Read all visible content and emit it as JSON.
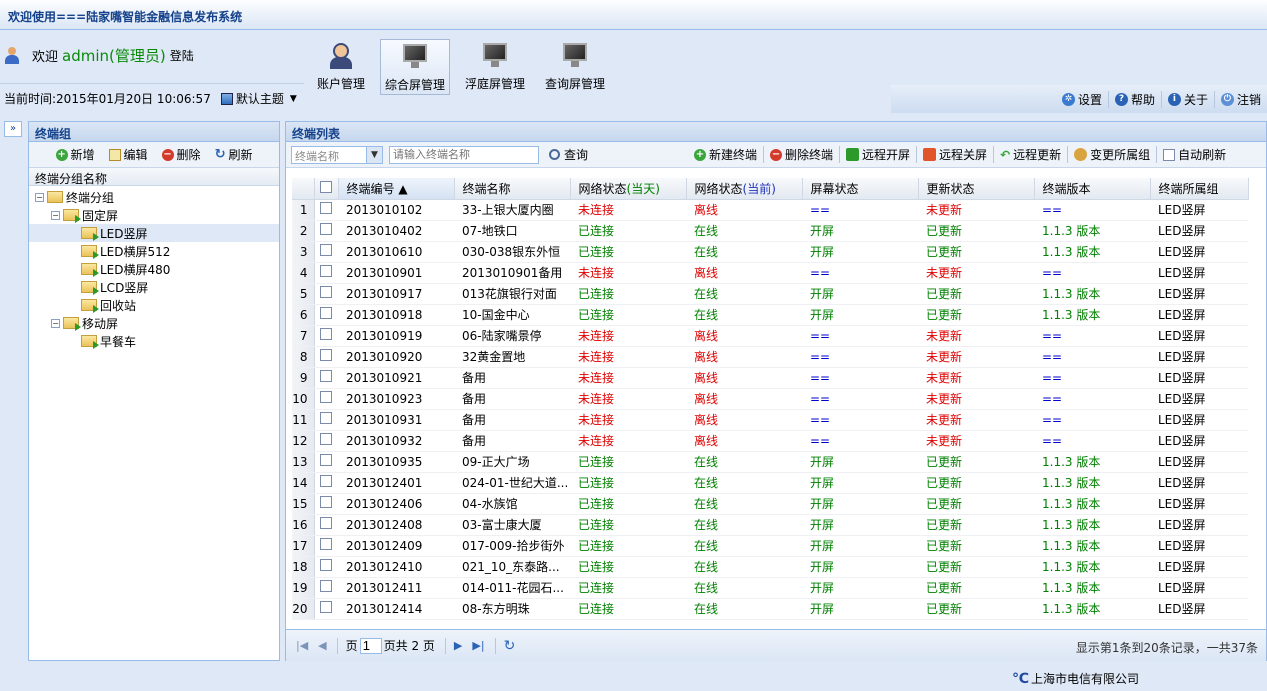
{
  "app": {
    "title": "欢迎使用===陆家嘴智能金融信息发布系统"
  },
  "header": {
    "welcome": "欢迎",
    "username": "admin(管理员)",
    "login": "登陆",
    "time_label": "当前时间:2015年01月20日 10:06:57",
    "theme": "默认主题",
    "nav": [
      {
        "label": "账户管理"
      },
      {
        "label": "综合屏管理"
      },
      {
        "label": "浮庭屏管理"
      },
      {
        "label": "查询屏管理"
      }
    ],
    "tools": [
      "设置",
      "帮助",
      "关于",
      "注销"
    ]
  },
  "left": {
    "title": "终端组",
    "buttons": {
      "add": "新增",
      "edit": "编辑",
      "delete": "删除",
      "refresh": "刷新"
    },
    "tree_header": "终端分组名称",
    "tree": {
      "root": "终端分组",
      "fixed": "固定屏",
      "fixed_children": [
        "LED竖屏",
        "LED横屏512",
        "LED横屏480",
        "LCD竖屏",
        "回收站"
      ],
      "mobile": "移动屏",
      "mobile_children": [
        "早餐车"
      ]
    }
  },
  "right": {
    "title": "终端列表",
    "combo": "终端名称",
    "search_placeholder": "请输入终端名称",
    "query": "查询",
    "actions": [
      "新建终端",
      "删除终端",
      "远程开屏",
      "远程关屏",
      "远程更新",
      "变更所属组",
      "自动刷新"
    ],
    "columns": [
      "终端编号 ▲",
      "终端名称",
      "网络状态(当天)",
      "网络状态(当前)",
      "屏幕状态",
      "更新状态",
      "终端版本",
      "终端所属组"
    ],
    "rows": [
      [
        "2013010102",
        "33-上银大厦内圈",
        "未连接",
        "离线",
        "==",
        "未更新",
        "==",
        "LED竖屏"
      ],
      [
        "2013010402",
        "07-地铁口",
        "已连接",
        "在线",
        "开屏",
        "已更新",
        "1.1.3 版本",
        "LED竖屏"
      ],
      [
        "2013010610",
        "030-038银东外恒",
        "已连接",
        "在线",
        "开屏",
        "已更新",
        "1.1.3 版本",
        "LED竖屏"
      ],
      [
        "2013010901",
        "2013010901备用",
        "未连接",
        "离线",
        "==",
        "未更新",
        "==",
        "LED竖屏"
      ],
      [
        "2013010917",
        "013花旗银行对面",
        "已连接",
        "在线",
        "开屏",
        "已更新",
        "1.1.3 版本",
        "LED竖屏"
      ],
      [
        "2013010918",
        "10-国金中心",
        "已连接",
        "在线",
        "开屏",
        "已更新",
        "1.1.3 版本",
        "LED竖屏"
      ],
      [
        "2013010919",
        "06-陆家嘴景停",
        "未连接",
        "离线",
        "==",
        "未更新",
        "==",
        "LED竖屏"
      ],
      [
        "2013010920",
        "32黄金置地",
        "未连接",
        "离线",
        "==",
        "未更新",
        "==",
        "LED竖屏"
      ],
      [
        "2013010921",
        "备用",
        "未连接",
        "离线",
        "==",
        "未更新",
        "==",
        "LED竖屏"
      ],
      [
        "2013010923",
        "备用",
        "未连接",
        "离线",
        "==",
        "未更新",
        "==",
        "LED竖屏"
      ],
      [
        "2013010931",
        "备用",
        "未连接",
        "离线",
        "==",
        "未更新",
        "==",
        "LED竖屏"
      ],
      [
        "2013010932",
        "备用",
        "未连接",
        "离线",
        "==",
        "未更新",
        "==",
        "LED竖屏"
      ],
      [
        "2013010935",
        "09-正大广场",
        "已连接",
        "在线",
        "开屏",
        "已更新",
        "1.1.3 版本",
        "LED竖屏"
      ],
      [
        "2013012401",
        "024-01-世纪大道...",
        "已连接",
        "在线",
        "开屏",
        "已更新",
        "1.1.3 版本",
        "LED竖屏"
      ],
      [
        "2013012406",
        "04-水族馆",
        "已连接",
        "在线",
        "开屏",
        "已更新",
        "1.1.3 版本",
        "LED竖屏"
      ],
      [
        "2013012408",
        "03-富士康大厦",
        "已连接",
        "在线",
        "开屏",
        "已更新",
        "1.1.3 版本",
        "LED竖屏"
      ],
      [
        "2013012409",
        "017-009-拾步街外",
        "已连接",
        "在线",
        "开屏",
        "已更新",
        "1.1.3 版本",
        "LED竖屏"
      ],
      [
        "2013012410",
        "021_10_东泰路...",
        "已连接",
        "在线",
        "开屏",
        "已更新",
        "1.1.3 版本",
        "LED竖屏"
      ],
      [
        "2013012411",
        "014-011-花园石...",
        "已连接",
        "在线",
        "开屏",
        "已更新",
        "1.1.3 版本",
        "LED竖屏"
      ],
      [
        "2013012414",
        "08-东方明珠",
        "已连接",
        "在线",
        "开屏",
        "已更新",
        "1.1.3 版本",
        "LED竖屏"
      ]
    ],
    "pager": {
      "page_prefix": "页",
      "page": "1",
      "page_total": "页共 2 页",
      "info": "显示第1条到20条记录，一共37条"
    }
  },
  "footer": {
    "company": "上海市电信有限公司"
  },
  "colors": {
    "red": "#e00000",
    "green": "#008000",
    "blue": "#0000cc",
    "header_blue": "#15428b"
  }
}
